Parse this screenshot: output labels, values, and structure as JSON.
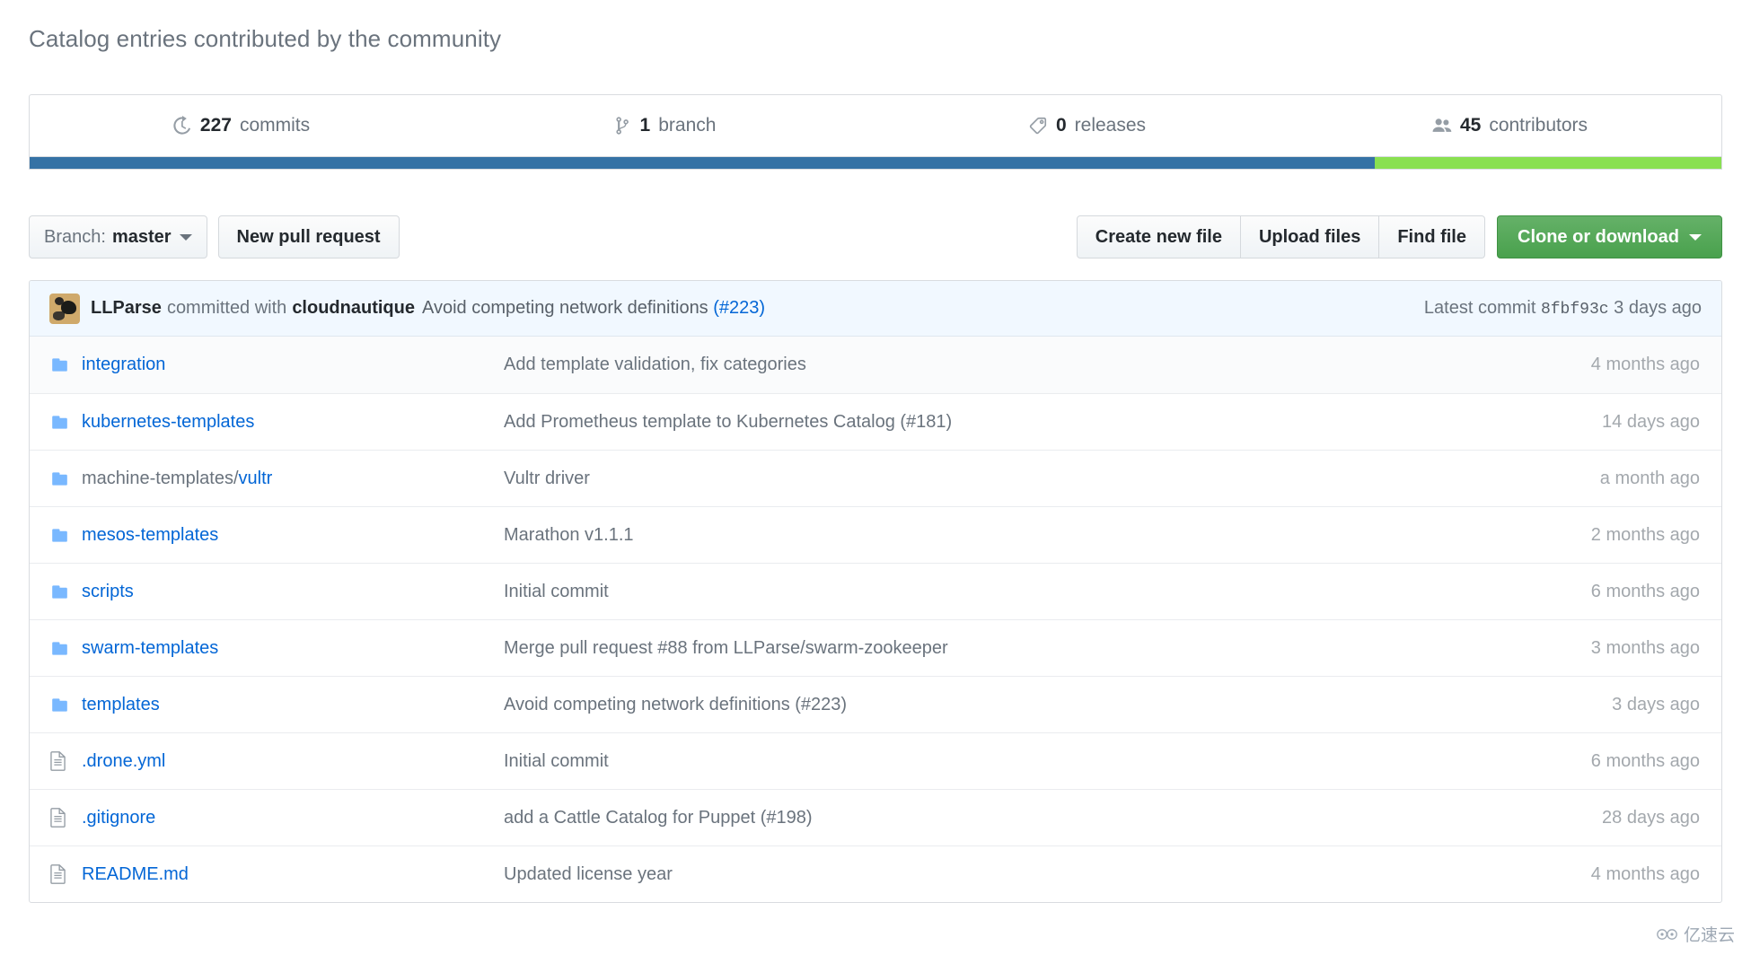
{
  "heading": "Catalog entries contributed by the community",
  "stats": [
    {
      "icon": "history-icon",
      "count": "227",
      "label": "commits"
    },
    {
      "icon": "branch-icon",
      "count": "1",
      "label": "branch"
    },
    {
      "icon": "tag-icon",
      "count": "0",
      "label": "releases"
    },
    {
      "icon": "people-icon",
      "count": "45",
      "label": "contributors"
    }
  ],
  "language_bar": [
    {
      "name": "primary",
      "color": "#3572A5",
      "percent": 79.5
    },
    {
      "name": "secondary",
      "color": "#89e051",
      "percent": 20.5
    }
  ],
  "toolbar": {
    "branch_prefix": "Branch:",
    "branch_name": "master",
    "new_pull_request": "New pull request",
    "create_new_file": "Create new file",
    "upload_files": "Upload files",
    "find_file": "Find file",
    "clone_or_download": "Clone or download"
  },
  "latest_commit": {
    "author": "LLParse",
    "committed_with": "committed with",
    "co_author": "cloudnautique",
    "message": "Avoid competing network definitions",
    "issue": "(#223)",
    "latest_label": "Latest commit",
    "sha": "8fbf93c",
    "age": "3 days ago"
  },
  "files": [
    {
      "type": "directory",
      "prefix": "",
      "name": "integration",
      "message": "Add template validation, fix categories",
      "age": "4 months ago"
    },
    {
      "type": "directory",
      "prefix": "",
      "name": "kubernetes-templates",
      "message": "Add Prometheus template to Kubernetes Catalog (#181)",
      "age": "14 days ago"
    },
    {
      "type": "directory",
      "prefix": "machine-templates/",
      "name": "vultr",
      "message": "Vultr driver",
      "age": "a month ago"
    },
    {
      "type": "directory",
      "prefix": "",
      "name": "mesos-templates",
      "message": "Marathon v1.1.1",
      "age": "2 months ago"
    },
    {
      "type": "directory",
      "prefix": "",
      "name": "scripts",
      "message": "Initial commit",
      "age": "6 months ago"
    },
    {
      "type": "directory",
      "prefix": "",
      "name": "swarm-templates",
      "message": "Merge pull request #88 from LLParse/swarm-zookeeper",
      "age": "3 months ago"
    },
    {
      "type": "directory",
      "prefix": "",
      "name": "templates",
      "message": "Avoid competing network definitions (#223)",
      "age": "3 days ago"
    },
    {
      "type": "file",
      "prefix": "",
      "name": ".drone.yml",
      "message": "Initial commit",
      "age": "6 months ago"
    },
    {
      "type": "file",
      "prefix": "",
      "name": ".gitignore",
      "message": "add a Cattle Catalog for Puppet (#198)",
      "age": "28 days ago"
    },
    {
      "type": "file",
      "prefix": "",
      "name": "README.md",
      "message": "Updated license year",
      "age": "4 months ago"
    }
  ],
  "watermark": {
    "text": "亿速云"
  },
  "colors": {
    "link": "#0366d6",
    "muted": "#6a737d",
    "green_button": "#49a14d",
    "commit_bar_bg": "#f1f8ff",
    "lang_blue": "#3572A5",
    "lang_green": "#89e051"
  }
}
